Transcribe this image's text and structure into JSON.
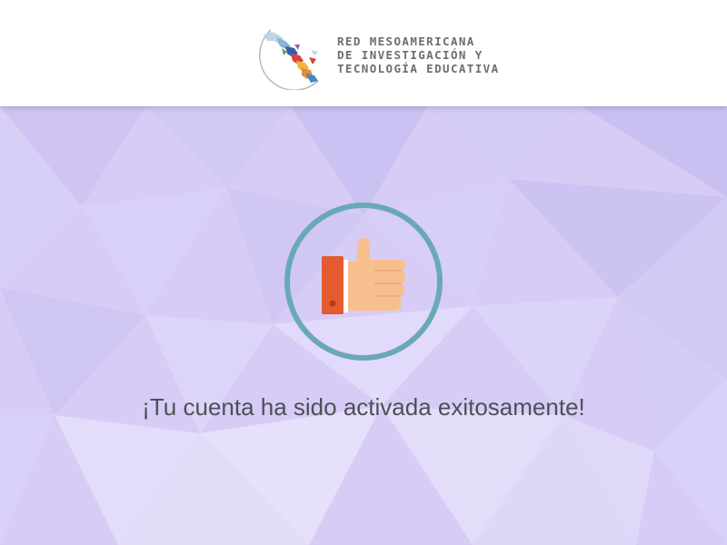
{
  "header": {
    "logo_lines": [
      "RED MESOAMERICANA",
      "DE INVESTIGACIÓN Y",
      "TECNOLOGÍA EDUCATIVA"
    ]
  },
  "main": {
    "icon": "thumbs-up-icon",
    "message": "¡Tu cuenta ha sido activada exitosamente!"
  },
  "colors": {
    "background": "#d6ccf5",
    "badge_ring": "#6aa8b8",
    "cuff": "#e35b2e",
    "hand": "#f8bf8e",
    "text": "#4f4f58",
    "logo_text": "#6d6d6d"
  }
}
